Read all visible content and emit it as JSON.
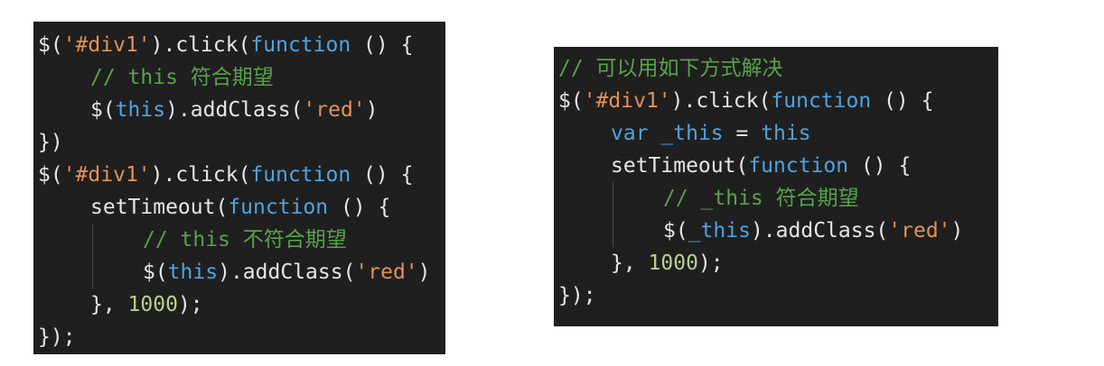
{
  "colors": {
    "background": "#ffffff",
    "panel": "#1f1f1f",
    "text": "#e6e6e6",
    "keyword": "#4fa3df",
    "string": "#e0915a",
    "number": "#b9d08f",
    "comment": "#58a24a"
  },
  "left": {
    "lines": [
      {
        "indent": 0,
        "tokens": [
          {
            "t": "$(",
            "c": "plain"
          },
          {
            "t": "'#div1'",
            "c": "str"
          },
          {
            "t": ").click(",
            "c": "plain"
          },
          {
            "t": "function",
            "c": "kw"
          },
          {
            "t": " () {",
            "c": "plain"
          }
        ]
      },
      {
        "indent": 1,
        "tokens": [
          {
            "t": "// this 符合期望",
            "c": "com"
          }
        ]
      },
      {
        "indent": 1,
        "tokens": [
          {
            "t": "$(",
            "c": "plain"
          },
          {
            "t": "this",
            "c": "kw"
          },
          {
            "t": ").addClass(",
            "c": "plain"
          },
          {
            "t": "'red'",
            "c": "str"
          },
          {
            "t": ")",
            "c": "plain"
          }
        ]
      },
      {
        "indent": 0,
        "tokens": [
          {
            "t": "})",
            "c": "plain"
          }
        ]
      },
      {
        "indent": 0,
        "tokens": [
          {
            "t": "$(",
            "c": "plain"
          },
          {
            "t": "'#div1'",
            "c": "str"
          },
          {
            "t": ").click(",
            "c": "plain"
          },
          {
            "t": "function",
            "c": "kw"
          },
          {
            "t": " () {",
            "c": "plain"
          }
        ]
      },
      {
        "indent": 1,
        "tokens": [
          {
            "t": "setTimeout(",
            "c": "plain"
          },
          {
            "t": "function",
            "c": "kw"
          },
          {
            "t": " () {",
            "c": "plain"
          }
        ]
      },
      {
        "indent": 2,
        "tokens": [
          {
            "t": "// this 不符合期望",
            "c": "com"
          }
        ]
      },
      {
        "indent": 2,
        "tokens": [
          {
            "t": "$(",
            "c": "plain"
          },
          {
            "t": "this",
            "c": "kw"
          },
          {
            "t": ").addClass(",
            "c": "plain"
          },
          {
            "t": "'red'",
            "c": "str"
          },
          {
            "t": ")",
            "c": "plain"
          }
        ]
      },
      {
        "indent": 1,
        "tokens": [
          {
            "t": "}, ",
            "c": "plain"
          },
          {
            "t": "1000",
            "c": "num"
          },
          {
            "t": ");",
            "c": "plain"
          }
        ]
      },
      {
        "indent": 0,
        "tokens": [
          {
            "t": "});",
            "c": "plain"
          }
        ]
      }
    ]
  },
  "right": {
    "lines": [
      {
        "indent": 0,
        "tokens": [
          {
            "t": "// 可以用如下方式解决",
            "c": "com"
          }
        ]
      },
      {
        "indent": 0,
        "tokens": [
          {
            "t": "$(",
            "c": "plain"
          },
          {
            "t": "'#div1'",
            "c": "str"
          },
          {
            "t": ").click(",
            "c": "plain"
          },
          {
            "t": "function",
            "c": "kw"
          },
          {
            "t": " () {",
            "c": "plain"
          }
        ]
      },
      {
        "indent": 1,
        "tokens": [
          {
            "t": "var",
            "c": "kw"
          },
          {
            "t": " ",
            "c": "plain"
          },
          {
            "t": "_this",
            "c": "kw"
          },
          {
            "t": " = ",
            "c": "plain"
          },
          {
            "t": "this",
            "c": "kw"
          }
        ]
      },
      {
        "indent": 1,
        "tokens": [
          {
            "t": "setTimeout(",
            "c": "plain"
          },
          {
            "t": "function",
            "c": "kw"
          },
          {
            "t": " () {",
            "c": "plain"
          }
        ]
      },
      {
        "indent": 2,
        "tokens": [
          {
            "t": "// _this 符合期望",
            "c": "com"
          }
        ]
      },
      {
        "indent": 2,
        "tokens": [
          {
            "t": "$(",
            "c": "plain"
          },
          {
            "t": "_this",
            "c": "kw"
          },
          {
            "t": ").addClass(",
            "c": "plain"
          },
          {
            "t": "'red'",
            "c": "str"
          },
          {
            "t": ")",
            "c": "plain"
          }
        ]
      },
      {
        "indent": 1,
        "tokens": [
          {
            "t": "}, ",
            "c": "plain"
          },
          {
            "t": "1000",
            "c": "num"
          },
          {
            "t": ");",
            "c": "plain"
          }
        ]
      },
      {
        "indent": 0,
        "tokens": [
          {
            "t": "});",
            "c": "plain"
          }
        ]
      }
    ]
  }
}
